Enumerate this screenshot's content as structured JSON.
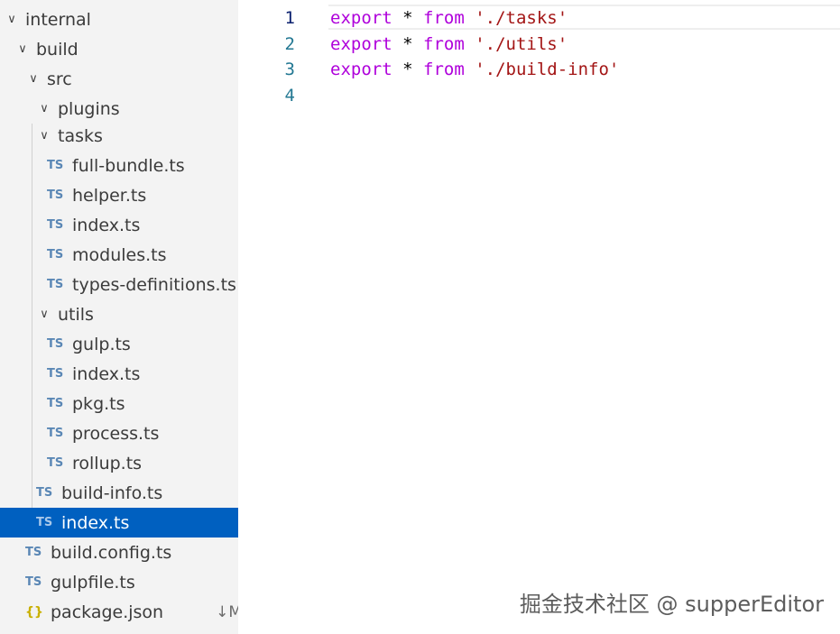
{
  "explorer": {
    "items": [
      {
        "label": "internal",
        "kind": "folder"
      },
      {
        "label": "build",
        "kind": "folder"
      },
      {
        "label": "src",
        "kind": "folder"
      },
      {
        "label": "plugins",
        "kind": "folder"
      },
      {
        "label": "tasks",
        "kind": "folder"
      },
      {
        "label": "full-bundle.ts",
        "kind": "ts",
        "icon_text": "TS"
      },
      {
        "label": "helper.ts",
        "kind": "ts",
        "icon_text": "TS"
      },
      {
        "label": "index.ts",
        "kind": "ts",
        "icon_text": "TS"
      },
      {
        "label": "modules.ts",
        "kind": "ts",
        "icon_text": "TS"
      },
      {
        "label": "types-definitions.ts",
        "kind": "ts",
        "icon_text": "TS"
      },
      {
        "label": "utils",
        "kind": "folder"
      },
      {
        "label": "gulp.ts",
        "kind": "ts",
        "icon_text": "TS"
      },
      {
        "label": "index.ts",
        "kind": "ts",
        "icon_text": "TS"
      },
      {
        "label": "pkg.ts",
        "kind": "ts",
        "icon_text": "TS"
      },
      {
        "label": "process.ts",
        "kind": "ts",
        "icon_text": "TS"
      },
      {
        "label": "rollup.ts",
        "kind": "ts",
        "icon_text": "TS"
      },
      {
        "label": "build-info.ts",
        "kind": "ts",
        "icon_text": "TS"
      },
      {
        "label": "index.ts",
        "kind": "ts",
        "icon_text": "TS",
        "selected": true
      },
      {
        "label": "build.config.ts",
        "kind": "ts",
        "icon_text": "TS"
      },
      {
        "label": "gulpfile.ts",
        "kind": "ts",
        "icon_text": "TS"
      },
      {
        "label": "package.json",
        "kind": "json",
        "icon_text": "{}",
        "badge": "↓M"
      }
    ]
  },
  "editor": {
    "lines": [
      {
        "num": "1",
        "kw": "export",
        "op": "*",
        "from": "from",
        "str": "'./tasks'"
      },
      {
        "num": "2",
        "kw": "export",
        "op": "*",
        "from": "from",
        "str": "'./utils'"
      },
      {
        "num": "3",
        "kw": "export",
        "op": "*",
        "from": "from",
        "str": "'./build-info'"
      },
      {
        "num": "4",
        "kw": "",
        "op": "",
        "from": "",
        "str": ""
      }
    ],
    "active_line": 1
  },
  "watermark": "掘金技术社区 @ supperEditor",
  "colors": {
    "sidebar_bg": "#f3f3f3",
    "selection_bg": "#0060c0",
    "keyword": "#af00db",
    "string": "#a31515",
    "line_number": "#237893",
    "ts_icon": "#5a87b5",
    "json_icon": "#c9b000"
  }
}
